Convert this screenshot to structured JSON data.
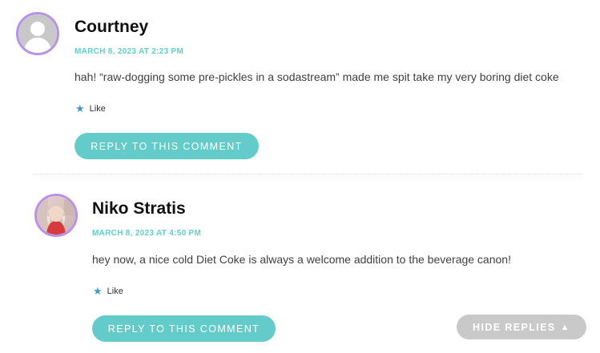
{
  "comments": [
    {
      "author": "Courtney",
      "date": "MARCH 8, 2023 AT 2:23 PM",
      "text": "hah! “raw-dogging some pre-pickles in a sodastream” made me spit take my very boring diet coke",
      "like_label": "Like",
      "reply_label": "REPLY TO THIS COMMENT",
      "avatar_icon": "default-avatar-icon"
    },
    {
      "author": "Niko Stratis",
      "date": "MARCH 8, 2023 AT 4:50 PM",
      "text": "hey now, a nice cold Diet Coke is always a welcome addition to the beverage canon!",
      "like_label": "Like",
      "reply_label": "REPLY TO THIS COMMENT",
      "avatar_icon": "user-photo-avatar"
    }
  ],
  "hide_replies": {
    "label": "HIDE REPLIES",
    "icon": "triangle-up-icon",
    "glyph": "▲"
  },
  "colors": {
    "accent": "#63ccca",
    "avatar_ring": "#b892ea",
    "like_star": "#3a99d8",
    "hide_button": "#c9c9c9"
  }
}
